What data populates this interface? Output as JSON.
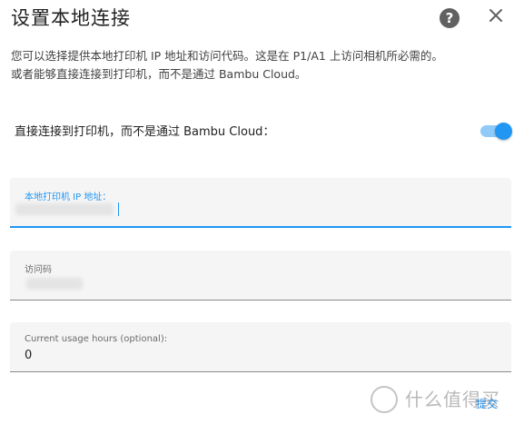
{
  "dialog": {
    "title": "设置本地连接",
    "description_line1": "您可以选择提供本地打印机 IP 地址和访问代码。这是在 P1/A1 上访问相机所必需的。",
    "description_line2": "或者能够直接连接到打印机，而不是通过 Bambu Cloud。",
    "help_icon": "help-circle-icon",
    "close_icon": "close-icon"
  },
  "toggle": {
    "label": "直接连接到打印机，而不是通过 Bambu Cloud：",
    "state": "on"
  },
  "fields": {
    "ip_label": "本地打印机 IP 地址：",
    "access_code_label": "访问码",
    "usage_hours_label": "Current usage hours (optional):",
    "usage_hours_value": "0"
  },
  "actions": {
    "submit_label": "提交"
  },
  "watermark": {
    "text": "什么值得买"
  },
  "colors": {
    "accent": "#2196f3",
    "toggle_track": "#90caf9",
    "field_bg": "#f5f5f5"
  }
}
